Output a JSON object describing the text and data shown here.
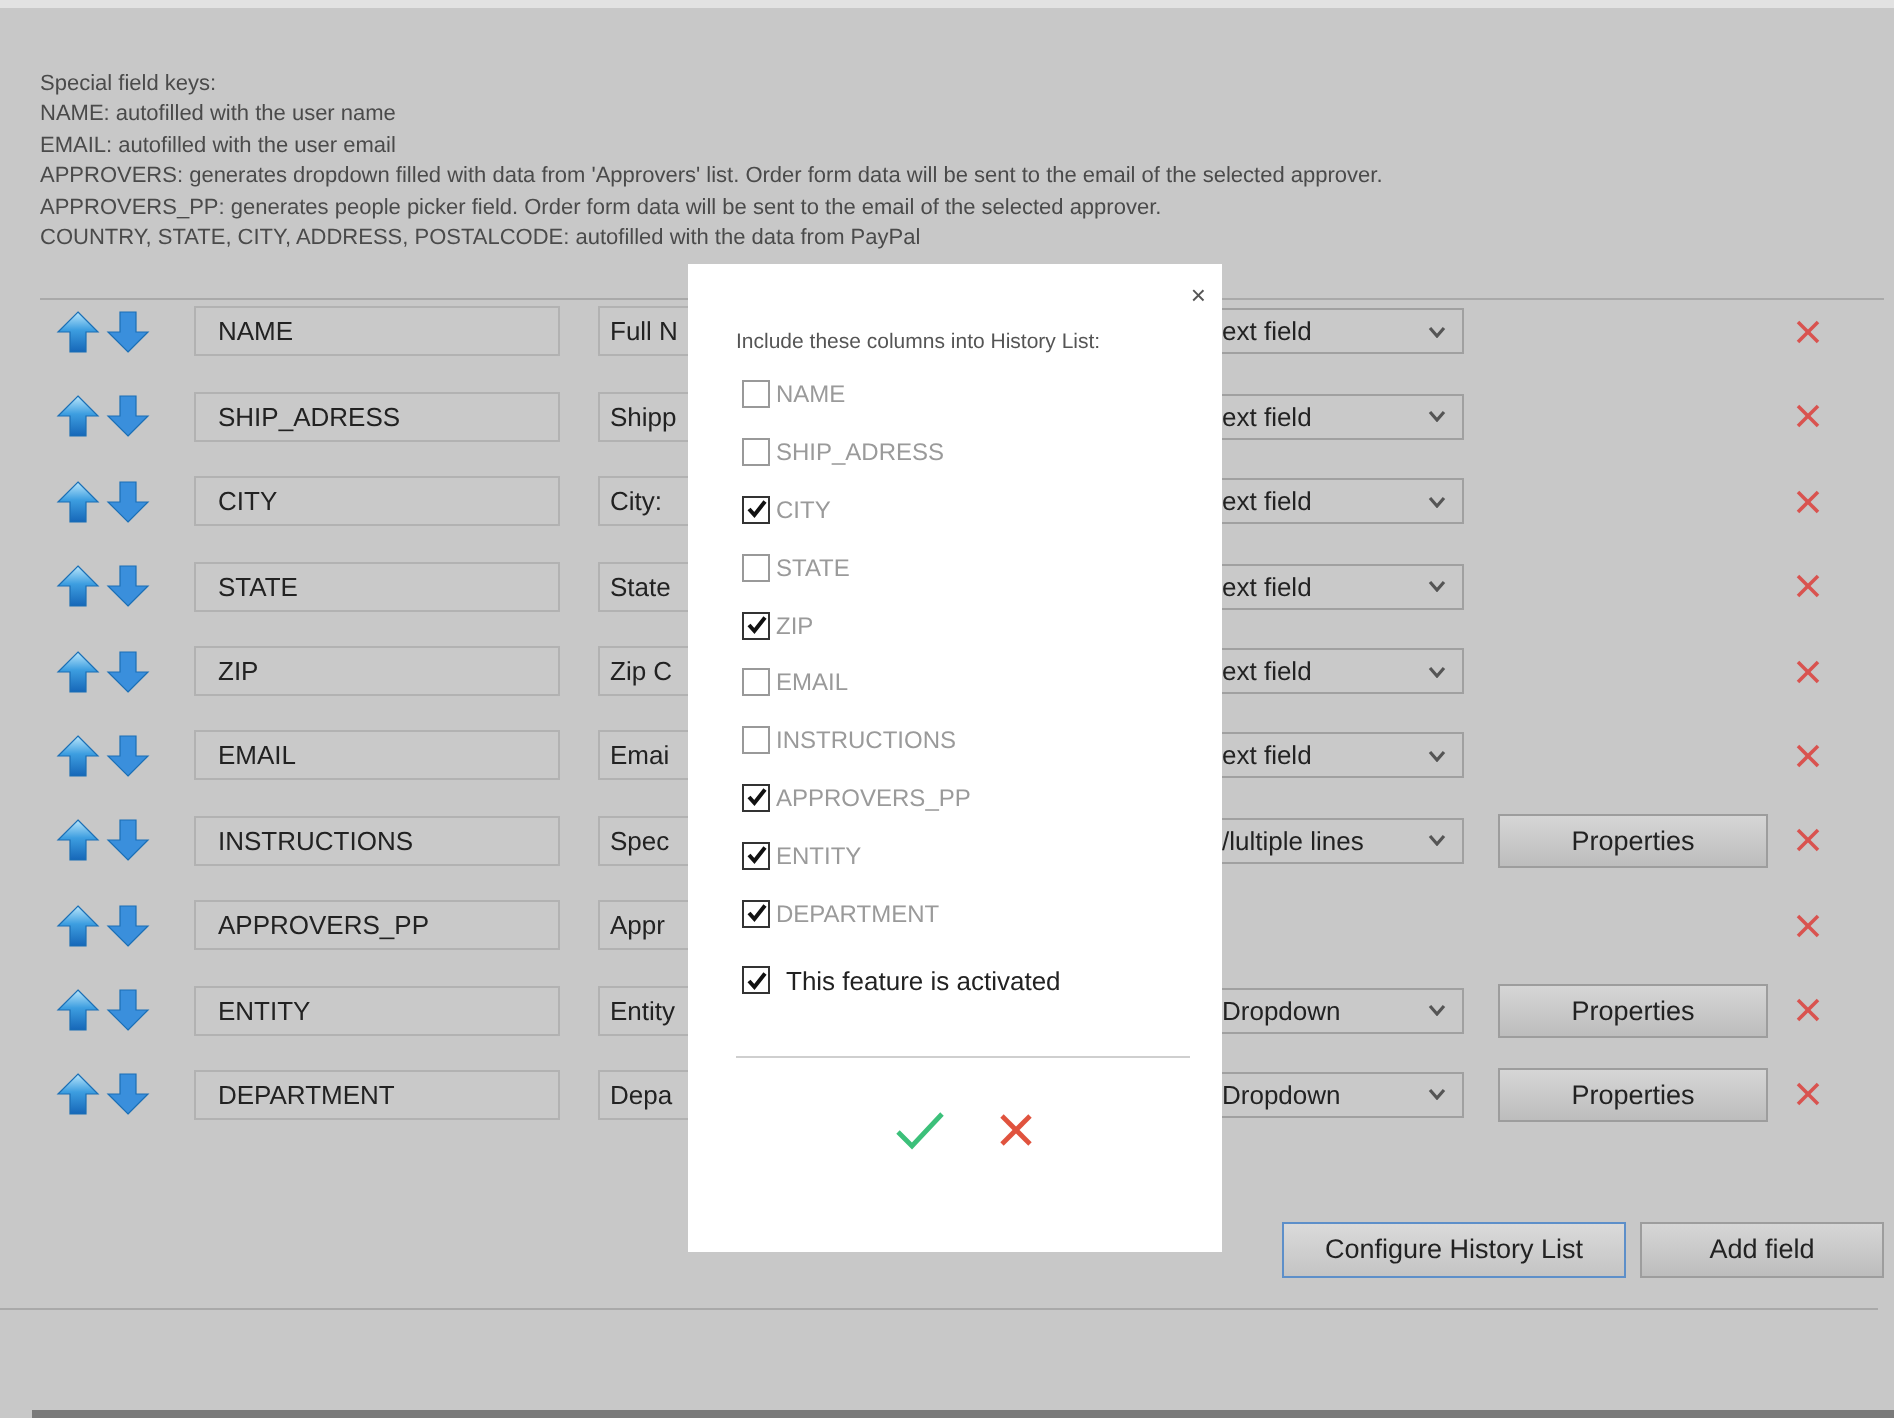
{
  "help": {
    "title": "Special field keys:",
    "lines": [
      "NAME: autofilled with the user name",
      "EMAIL: autofilled with the user email",
      "APPROVERS: generates dropdown filled with data from 'Approvers' list. Order form data will be sent to the email of the selected approver.",
      "APPROVERS_PP: generates people picker field. Order form data will be sent to the email of the selected approver.",
      "COUNTRY, STATE, CITY, ADDRESS, POSTALCODE: autofilled with the data from PayPal"
    ]
  },
  "fields": [
    {
      "key": "NAME",
      "label": "Full N",
      "type": "ext field"
    },
    {
      "key": "SHIP_ADRESS",
      "label": "Shipp",
      "type": "ext field"
    },
    {
      "key": "CITY",
      "label": "City:",
      "type": "ext field"
    },
    {
      "key": "STATE",
      "label": "State",
      "type": "ext field"
    },
    {
      "key": "ZIP",
      "label": "Zip C",
      "type": "ext field"
    },
    {
      "key": "EMAIL",
      "label": "Emai",
      "type": "ext field"
    },
    {
      "key": "INSTRUCTIONS",
      "label": "Spec",
      "type": "/lultiple lines",
      "properties": "Properties"
    },
    {
      "key": "APPROVERS_PP",
      "label": "Appr"
    },
    {
      "key": "ENTITY",
      "label": "Entity",
      "type": "Dropdown",
      "properties": "Properties"
    },
    {
      "key": "DEPARTMENT",
      "label": "Depa",
      "type": "Dropdown",
      "properties": "Properties"
    }
  ],
  "actions": [
    {
      "label": "Configure History List",
      "focused": true
    },
    {
      "label": "Add field",
      "focused": false
    }
  ],
  "dialog": {
    "close": "×",
    "heading": "Include these columns into History List:",
    "columns": [
      {
        "label": "NAME",
        "checked": false
      },
      {
        "label": "SHIP_ADRESS",
        "checked": false
      },
      {
        "label": "CITY",
        "checked": true
      },
      {
        "label": "STATE",
        "checked": false
      },
      {
        "label": "ZIP",
        "checked": true
      },
      {
        "label": "EMAIL",
        "checked": false
      },
      {
        "label": "INSTRUCTIONS",
        "checked": false
      },
      {
        "label": "APPROVERS_PP",
        "checked": true
      },
      {
        "label": "ENTITY",
        "checked": true
      },
      {
        "label": "DEPARTMENT",
        "checked": true
      }
    ],
    "activation": {
      "label": "This feature is activated",
      "checked": true
    }
  }
}
